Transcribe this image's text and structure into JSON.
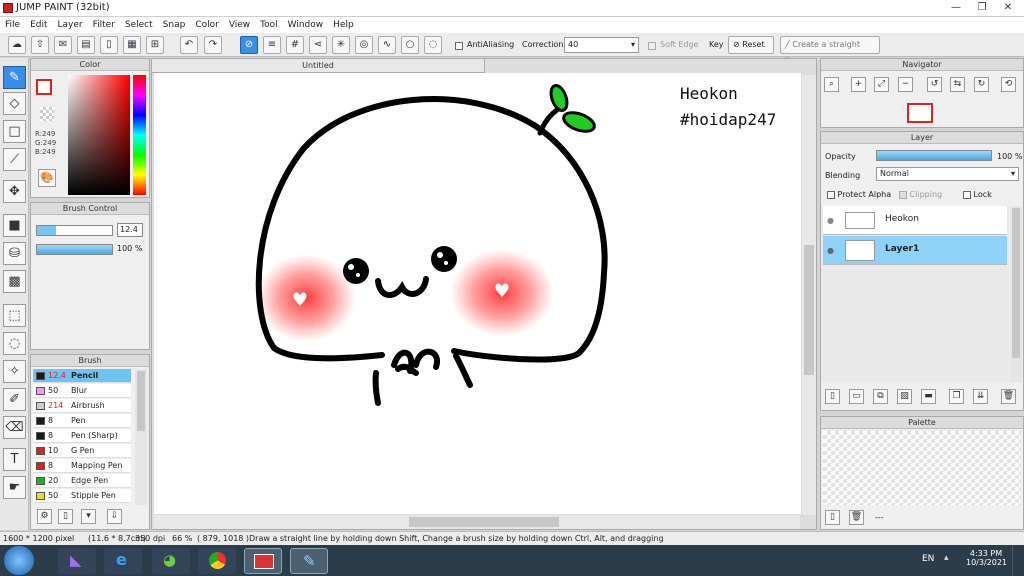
{
  "app": {
    "title": "JUMP PAINT (32bit)"
  },
  "window_controls": {
    "minimize": "—",
    "maximize": "❐",
    "close": "✕"
  },
  "menu": [
    "File",
    "Edit",
    "Layer",
    "Filter",
    "Select",
    "Snap",
    "Color",
    "View",
    "Tool",
    "Window",
    "Help"
  ],
  "toolbar": {
    "antialiasing": "AntiAliasing",
    "correction_label": "Correction",
    "correction_value": "40",
    "soft_edge": "Soft Edge",
    "key_label": "Key",
    "reset": "Reset",
    "straight_line": "Create a straight line"
  },
  "color_panel": {
    "title": "Color",
    "r": "R:249",
    "g": "G:249",
    "b": "B:249"
  },
  "brush_control": {
    "title": "Brush Control",
    "size": "12.4",
    "opacity": "100 %"
  },
  "brush_panel": {
    "title": "Brush",
    "items": [
      {
        "size": "12.4",
        "name": "Pencil",
        "color": "#1a1a1a"
      },
      {
        "size": "50",
        "name": "Blur",
        "color": "#e8a0e8"
      },
      {
        "size": "214",
        "name": "Airbrush",
        "color": "#cccccc"
      },
      {
        "size": "8",
        "name": "Pen",
        "color": "#1a1a1a"
      },
      {
        "size": "8",
        "name": "Pen (Sharp)",
        "color": "#1a1a1a"
      },
      {
        "size": "10",
        "name": "G Pen",
        "color": "#e02020"
      },
      {
        "size": "8",
        "name": "Mapping Pen",
        "color": "#e02020"
      },
      {
        "size": "20",
        "name": "Edge Pen",
        "color": "#20b020"
      },
      {
        "size": "50",
        "name": "Stipple Pen",
        "color": "#e0e020"
      }
    ]
  },
  "canvas": {
    "tab": "Untitled",
    "text_line1": "Heokon",
    "text_line2": "#hoidap247"
  },
  "navigator": {
    "title": "Navigator"
  },
  "layer_panel": {
    "title": "Layer",
    "opacity_label": "Opacity",
    "opacity_value": "100 %",
    "opacity_fraction": 1.0,
    "blending_label": "Blending",
    "blending_value": "Normal",
    "protect_alpha": "Protect Alpha",
    "clipping": "Clipping",
    "lock": "Lock",
    "layers": [
      {
        "name": "Heokon"
      },
      {
        "name": "Layer1"
      }
    ]
  },
  "palette": {
    "title": "Palette",
    "more": "---"
  },
  "status": {
    "size": "1600 * 1200 pixel",
    "cm": "(11.6 * 8.7cm)",
    "dpi": "350 dpi",
    "zoom": "66 %",
    "coords": "( 879, 1018 )",
    "hint": "Draw a straight line by holding down Shift, Change a brush size by holding down Ctrl, Alt, and dragging"
  },
  "taskbar": {
    "lang": "EN",
    "time": "4:33 PM",
    "date": "10/3/2021"
  },
  "colors": {
    "accent": "#3a8ee6",
    "selected_row": "#8ed3f7",
    "blush": "#ff4a4a",
    "leaf": "#22cc22"
  }
}
